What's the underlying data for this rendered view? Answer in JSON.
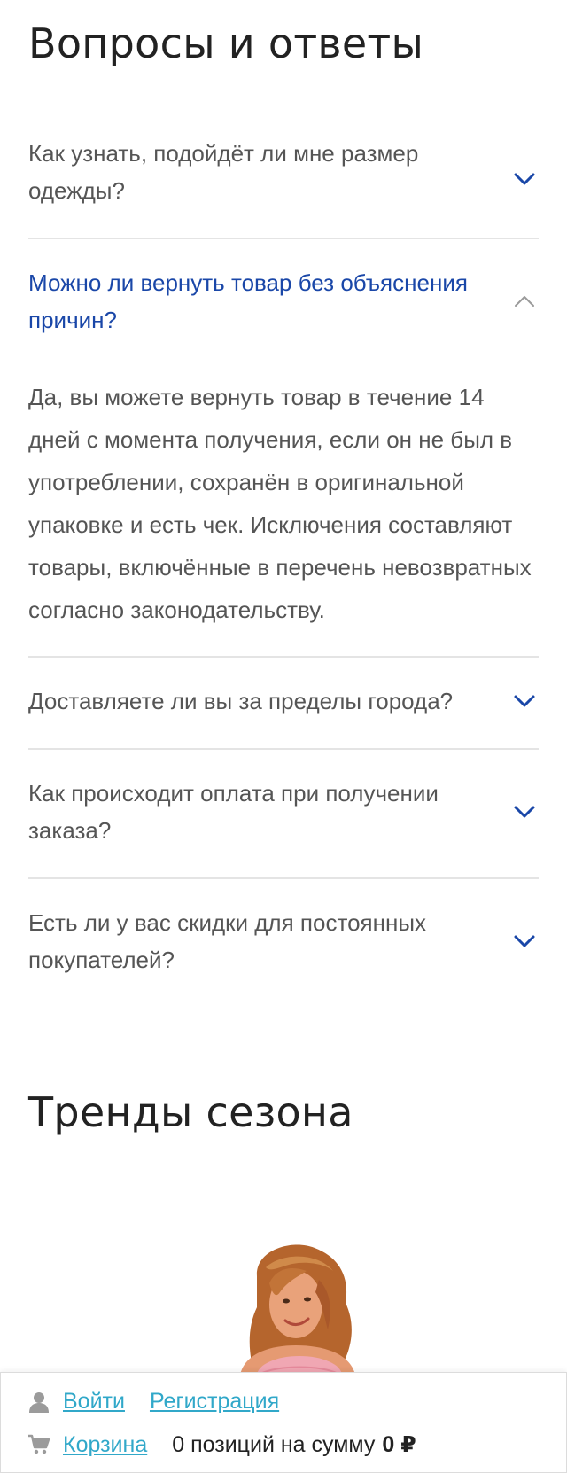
{
  "faq": {
    "title": "Вопросы и ответы",
    "items": [
      {
        "question": "Как узнать, подойдёт ли мне размер одежды?",
        "answer": "",
        "open": false
      },
      {
        "question": "Можно ли вернуть товар без объяснения причин?",
        "answer": "Да, вы можете вернуть товар в течение 14 дней с момента получения, если он не был в употреблении, сохранён в оригинальной упаковке и есть чек. Исключения составляют товары, включённые в перечень невозвратных согласно законодательству.",
        "open": true
      },
      {
        "question": "Доставляете ли вы за пределы города?",
        "answer": "",
        "open": false
      },
      {
        "question": "Как происходит оплата при получении заказа?",
        "answer": "",
        "open": false
      },
      {
        "question": "Есть ли у вас скидки для постоянных покупателей?",
        "answer": "",
        "open": false
      }
    ]
  },
  "trends": {
    "title": "Тренды сезона"
  },
  "bottom_bar": {
    "login_label": "Войти",
    "register_label": "Регистрация",
    "cart_label": "Корзина",
    "cart_summary": "0 позиций на сумму",
    "cart_total": "0 ₽"
  },
  "colors": {
    "accent": "#1a47a8",
    "link": "#31a8c9",
    "divider": "#e4e4e4"
  },
  "icons": {
    "collapsed": "chevron-down-icon",
    "expanded": "chevron-up-icon",
    "user": "user-icon",
    "cart": "cart-icon"
  }
}
